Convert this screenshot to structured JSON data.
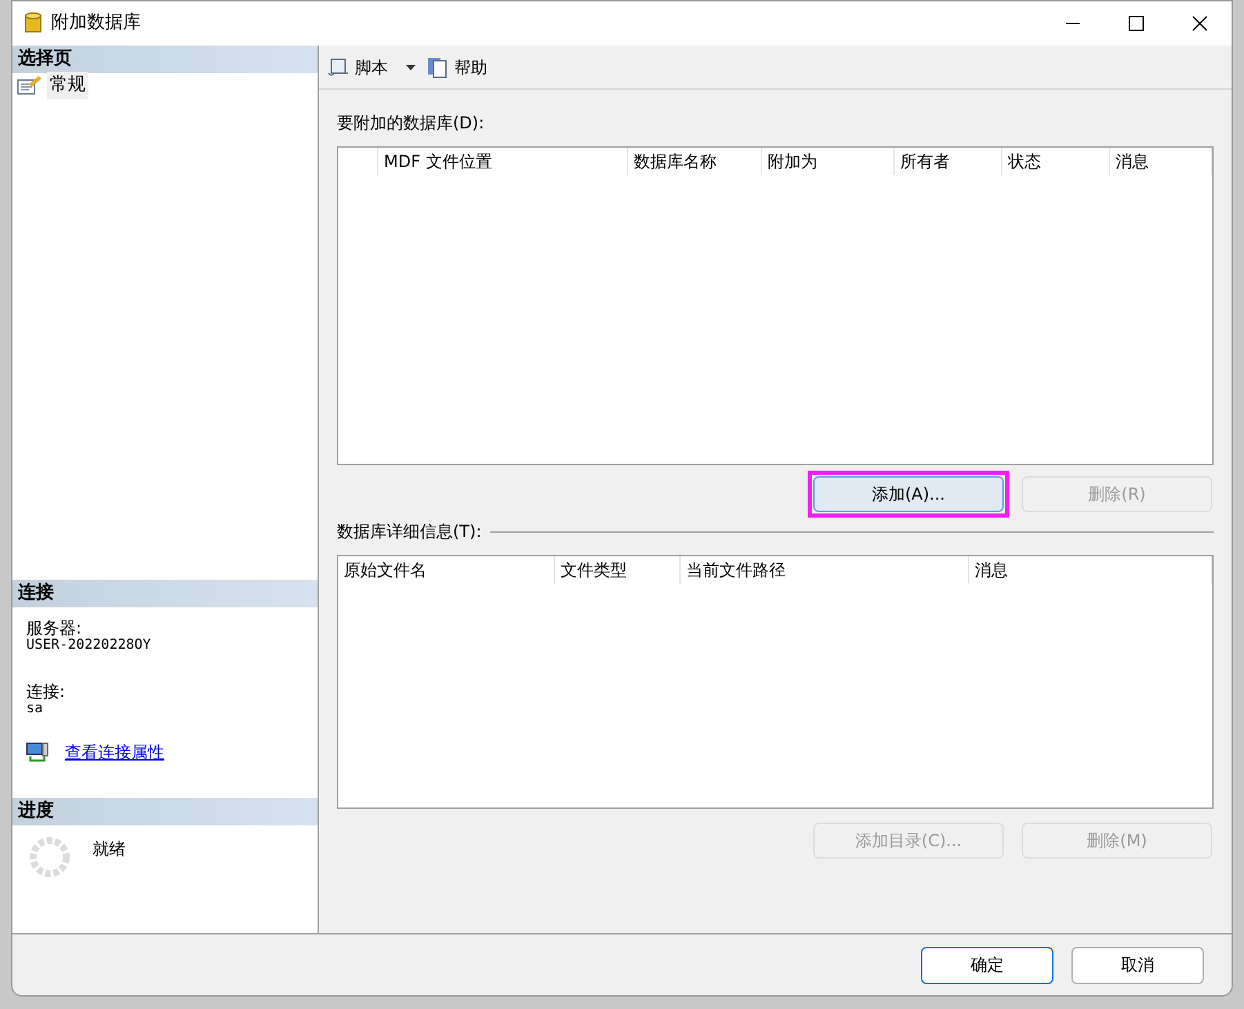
{
  "window": {
    "title": "附加数据库"
  },
  "sidebar": {
    "header": "选择页",
    "items": [
      {
        "label": "常规",
        "selected": true
      }
    ]
  },
  "connection": {
    "header": "连接",
    "server_label": "服务器:",
    "server": "USER-20220228OY",
    "login_label": "连接:",
    "login": "sa",
    "link": "查看连接属性"
  },
  "progress": {
    "header": "进度",
    "status": "就绪"
  },
  "toolbar": {
    "script": "脚本",
    "help": "帮助"
  },
  "databases": {
    "label": "要附加的数据库(D):",
    "columns": [
      "",
      "MDF 文件位置",
      "数据库名称",
      "附加为",
      "所有者",
      "状态",
      "消息"
    ],
    "buttons": [
      {
        "label": "添加(A)...",
        "disabled": false,
        "highlighted": true
      },
      {
        "label": "删除(R)",
        "disabled": true,
        "highlighted": false
      }
    ]
  },
  "details": {
    "label": "数据库详细信息(T):",
    "columns": [
      "原始文件名",
      "文件类型",
      "当前文件路径",
      "消息"
    ],
    "buttons": [
      {
        "label": "添加目录(C)...",
        "disabled": true,
        "highlighted": false
      },
      {
        "label": "删除(M)",
        "disabled": true,
        "highlighted": false
      }
    ]
  },
  "footer": {
    "buttons": [
      {
        "label": "确定",
        "default": true
      },
      {
        "label": "取消",
        "default": false
      }
    ]
  }
}
